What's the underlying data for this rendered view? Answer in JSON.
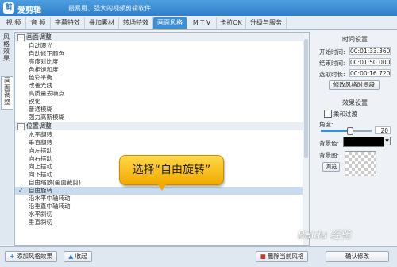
{
  "app": {
    "logo": "剪",
    "name": "爱剪辑",
    "slogan": "最易用、强大的视频剪辑软件"
  },
  "tabs": [
    {
      "label": "视  频",
      "active": false
    },
    {
      "label": "音  频",
      "active": false
    },
    {
      "label": "字幕特效",
      "active": false
    },
    {
      "label": "叠加素材",
      "active": false
    },
    {
      "label": "转场特效",
      "active": false
    },
    {
      "label": "画面风格",
      "active": true
    },
    {
      "label": "M T V",
      "active": false
    },
    {
      "label": "卡拉OK",
      "active": false
    },
    {
      "label": "升级与服务",
      "active": false
    }
  ],
  "sidebar_tabs": [
    {
      "label": "风格效果",
      "active": false
    },
    {
      "label": "画面调整",
      "active": true
    }
  ],
  "groups": [
    {
      "label": "画面调整",
      "expand": "⊟",
      "items": [
        "自动曝光",
        "自动修正颜色",
        "亮度对比度",
        "色相饱和度",
        "色彩平衡",
        "改善光线",
        "高质量去噪点",
        "锐化",
        "普通模糊",
        "强力高斯模糊"
      ]
    },
    {
      "label": "位置调整",
      "expand": "⊟",
      "items": [
        "水平翻转",
        "垂直翻转",
        "向左摆动",
        "向右摆动",
        "向上摆动",
        "向下摆动",
        "自由缩放(画面裁剪)",
        "自由旋转",
        "沿水平中轴转动",
        "沿垂直中轴转动",
        "水平斜切",
        "垂直斜切"
      ]
    }
  ],
  "selected_item": "自由旋转",
  "selected_check": "✓",
  "time_settings": {
    "title": "时间设置",
    "start_label": "开始时间:",
    "start_value": "00:01:33.360",
    "end_label": "结束时间:",
    "end_value": "00:01:50.000",
    "duration_label": "选取时长:",
    "duration_value": "00:00:16.720",
    "modify_button": "修改风格时间段"
  },
  "effect_settings": {
    "title": "效果设置",
    "soft_transition_label": "柔和过渡",
    "angle_label": "角度:",
    "angle_value": "20",
    "angle_fraction": 0.55,
    "bgcolor_label": "背景色:",
    "bgcolor_hex": "#000000",
    "bgimage_label": "背景图:",
    "browse_label": "浏览"
  },
  "bottom": {
    "add_style_label": "添加风格效果",
    "collapse_label": "收起",
    "delete_style_label": "删除当前风格",
    "confirm_label": "确认修改"
  },
  "callout": {
    "text": "选择“自由旋转”"
  },
  "watermark": "Baidu 经验",
  "colors": {
    "accent": "#3b8fd8",
    "callout": "#f2a900"
  }
}
